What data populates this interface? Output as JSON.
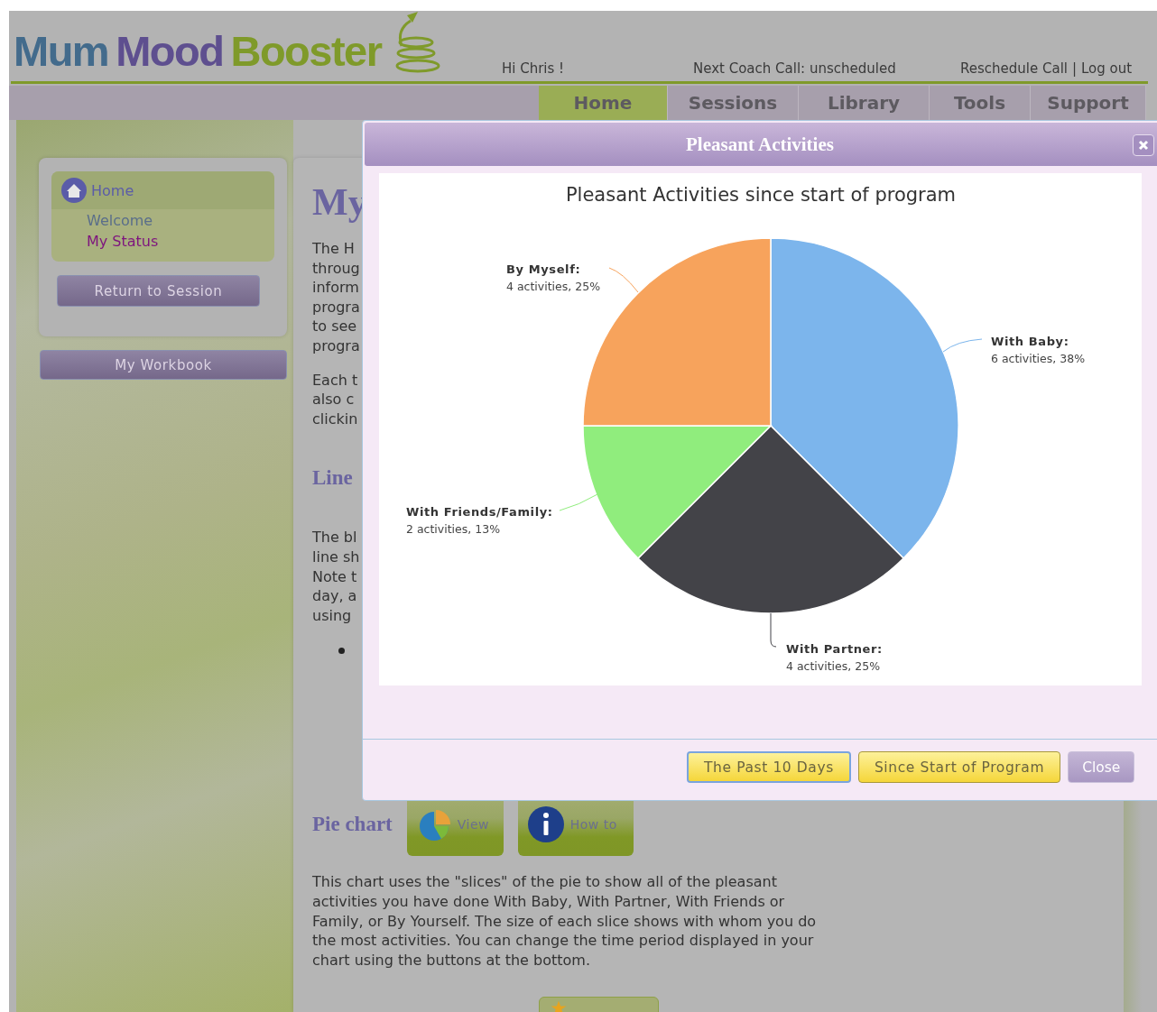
{
  "header": {
    "logo": [
      "Mum",
      "Mood",
      "Booster"
    ],
    "greeting": "Hi Chris !",
    "next_call": "Next Coach Call: unscheduled",
    "links": [
      "Reschedule Call",
      "Log out"
    ],
    "separator": "|"
  },
  "nav": [
    {
      "label": "Home",
      "selected": true
    },
    {
      "label": "Sessions",
      "selected": false
    },
    {
      "label": "Library",
      "selected": false
    },
    {
      "label": "Tools",
      "selected": false
    },
    {
      "label": "Support",
      "selected": false
    }
  ],
  "sidebar": {
    "home": "Home",
    "items": [
      {
        "label": "Welcome",
        "selected": false
      },
      {
        "label": "My Status",
        "selected": true
      }
    ],
    "return_button": "Return to Session",
    "workbook_button": "My Workbook"
  },
  "content": {
    "heading": "My",
    "para_1": "The H\nthroug\ninform\nprogra\nto see\nprogra",
    "para_2": "Each t\nalso c\nclickin",
    "line_heading": "Line",
    "para_3": "The bl\nline sh\nNote t\nday, a\nusing",
    "pie_heading": "Pie chart",
    "view_button": "View",
    "howto_button": "How to",
    "pie_text": "This chart uses the \"slices\" of the pie to show all of the pleasant activities you have done With Baby, With Partner, With Friends or Family, or By Yourself. The size of each slice shows with whom you do the most activities. You can change the time period displayed in your chart using the buttons at the bottom."
  },
  "dialog": {
    "title": "Pleasant Activities",
    "label_separator": ":",
    "chart_data": {
      "type": "pie",
      "title": "Pleasant Activities since start of program",
      "categories": [
        "With Baby",
        "With Partner",
        "With Friends/Family",
        "By Myself"
      ],
      "values": [
        6,
        4,
        2,
        4
      ],
      "colors": [
        "#7cb5ec",
        "#434348",
        "#90ed7d",
        "#f7a35c"
      ],
      "value_labels": [
        "6 activities, 38%",
        "4 activities, 25%",
        "2 activities, 13%",
        "4 activities, 25%"
      ]
    },
    "buttons": [
      {
        "label": "The Past 10 Days",
        "kind": "period",
        "focused": true
      },
      {
        "label": "Since Start of Program",
        "kind": "period",
        "focused": false
      },
      {
        "label": "Close",
        "kind": "close",
        "focused": false
      }
    ]
  }
}
